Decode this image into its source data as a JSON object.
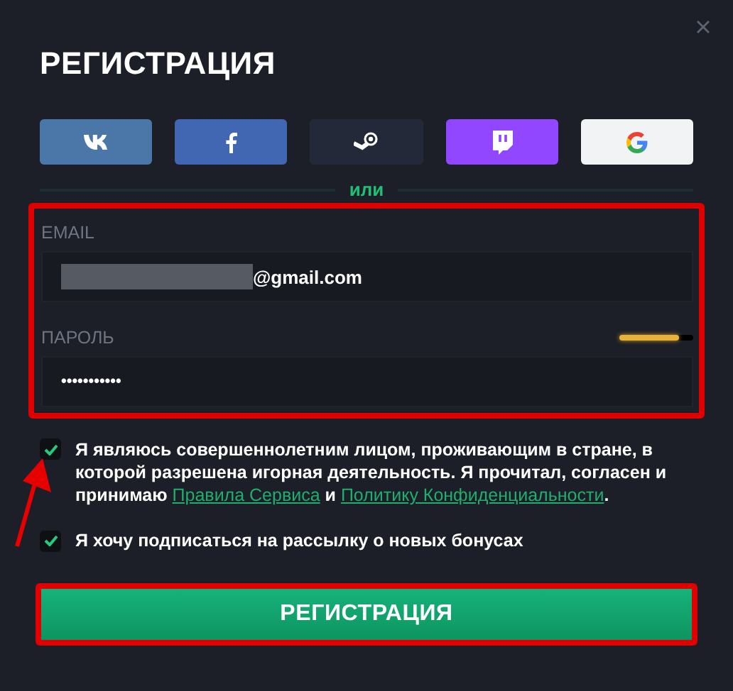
{
  "title": "РЕГИСТРАЦИЯ",
  "social_buttons": [
    {
      "kind": "vk"
    },
    {
      "kind": "facebook"
    },
    {
      "kind": "steam"
    },
    {
      "kind": "twitch"
    },
    {
      "kind": "google"
    }
  ],
  "divider": "или",
  "email": {
    "label": "EMAIL",
    "value": "@gmail.com",
    "redacted": true
  },
  "password": {
    "label": "ПАРОЛЬ",
    "value": "•••••••••••",
    "level": 0.8
  },
  "consent": {
    "checked": true,
    "parts": [
      {
        "kind": "text",
        "text": "Я являюсь совершеннолетним лицом, проживающим в стране, в которой разрешена игорная деятельность. Я прочитал, согласен и принимаю "
      },
      {
        "kind": "link",
        "text": "Правила Сервиса"
      },
      {
        "kind": "text",
        "text": " и "
      },
      {
        "kind": "link",
        "text": "Политику Конфиденциальности"
      },
      {
        "kind": "text",
        "text": "."
      }
    ]
  },
  "newsletter": {
    "checked": true,
    "text": "Я хочу подписаться на рассылку о новых бонусах"
  },
  "submit": "РЕГИСТРАЦИЯ"
}
